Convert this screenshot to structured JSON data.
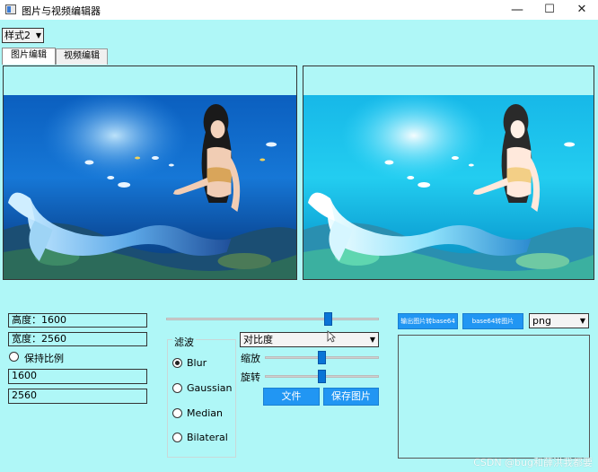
{
  "window": {
    "title": "图片与视频编辑器",
    "minimize_glyph": "—",
    "maximize_glyph": "☐",
    "close_glyph": "✕"
  },
  "style_select": {
    "value": "样式2",
    "arrow": "▼"
  },
  "tabs": [
    {
      "label": "图片编辑",
      "active": true
    },
    {
      "label": "视频编辑",
      "active": false
    }
  ],
  "image_editor": {
    "height_label": "高度：1600",
    "width_label": "宽度：2560",
    "keep_ratio_label": "保持比例",
    "height_value": "1600",
    "width_value": "2560",
    "filter_group_title": "滤波",
    "filters": [
      {
        "label": "Blur",
        "checked": true
      },
      {
        "label": "Gaussian",
        "checked": false
      },
      {
        "label": "Median",
        "checked": false
      },
      {
        "label": "Bilateral",
        "checked": false
      }
    ],
    "adjust_select": {
      "value": "对比度",
      "arrow": "▼"
    },
    "zoom_label": "缩放",
    "rotate_label": "旋转",
    "file_button": "文件",
    "save_button": "保存图片",
    "top_slider_level": 0.77,
    "zoom_slider_level": 0.5,
    "rotate_slider_level": 0.5
  },
  "base64": {
    "to_base64_button": "输出图片转base64",
    "from_base64_button": "base64转图片",
    "format_select": {
      "value": "png",
      "arrow": "▼"
    },
    "text": ""
  },
  "watermark": "CSDN @bug和薛洪我都要",
  "colors": {
    "background": "#aff7f7",
    "button": "#2196f3",
    "slider_thumb": "#0a74d6"
  }
}
